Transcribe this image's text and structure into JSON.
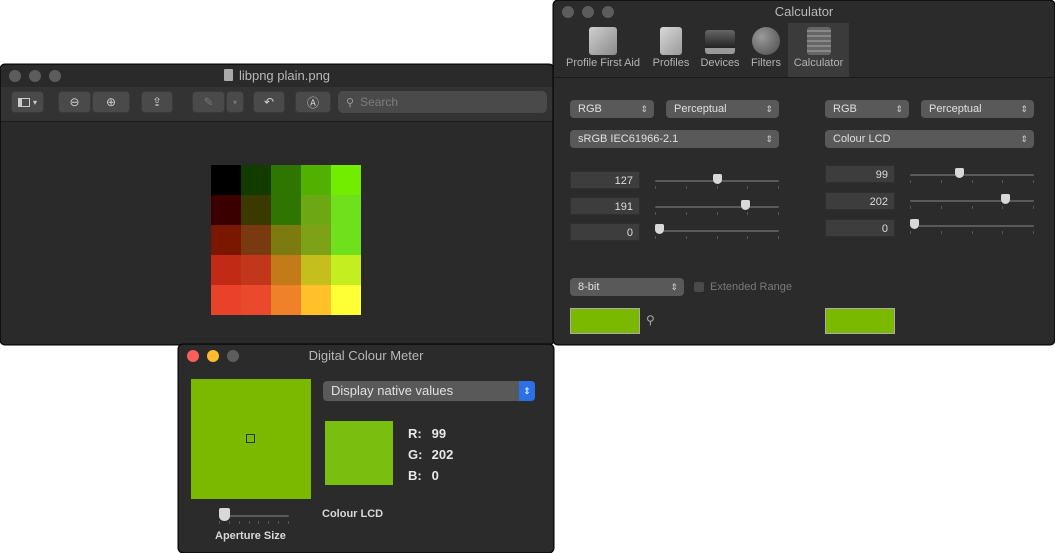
{
  "colors": {
    "sample": "#7ab900",
    "meter_sample": "#7abf10"
  },
  "preview": {
    "title": "libpng plain.png",
    "search_placeholder": "Search",
    "image_cells": [
      "#000000",
      "#123b00",
      "#2e7600",
      "#52b000",
      "#72ed00",
      "#3a0000",
      "#3a3a00",
      "#2e7600",
      "#6da713",
      "#6ee11c",
      "#7a1700",
      "#7a3a10",
      "#7b7b10",
      "#7da218",
      "#6ee11c",
      "#c12a14",
      "#c2361c",
      "#c27b18",
      "#c4bf1d",
      "#c5ee20",
      "#e8432a",
      "#ea4a2c",
      "#ef812a",
      "#ffc02a",
      "#ffff35"
    ]
  },
  "calculator": {
    "title": "Calculator",
    "tabs": [
      {
        "label": "Profile First Aid",
        "icon": "profile-first-aid-icon"
      },
      {
        "label": "Profiles",
        "icon": "profiles-icon"
      },
      {
        "label": "Devices",
        "icon": "devices-icon"
      },
      {
        "label": "Filters",
        "icon": "filters-icon"
      },
      {
        "label": "Calculator",
        "icon": "calculator-icon"
      }
    ],
    "left": {
      "space": "RGB",
      "intent": "Perceptual",
      "profile": "sRGB IEC61966-2.1",
      "values": [
        "127",
        "191",
        "0"
      ],
      "levels": [
        0.5,
        0.75,
        0.0
      ]
    },
    "right": {
      "space": "RGB",
      "intent": "Perceptual",
      "profile": "Colour LCD",
      "values": [
        "99",
        "202",
        "0"
      ],
      "levels": [
        0.39,
        0.79,
        0.0
      ]
    },
    "depth": "8-bit",
    "extended_range": "Extended Range"
  },
  "meter": {
    "title": "Digital Colour Meter",
    "mode": "Display native values",
    "r_label": "R:",
    "r": "99",
    "g_label": "G:",
    "g": "202",
    "b_label": "B:",
    "b": "0",
    "profile": "Colour LCD",
    "aperture_label": "Aperture Size",
    "aperture_level": 0.0
  }
}
